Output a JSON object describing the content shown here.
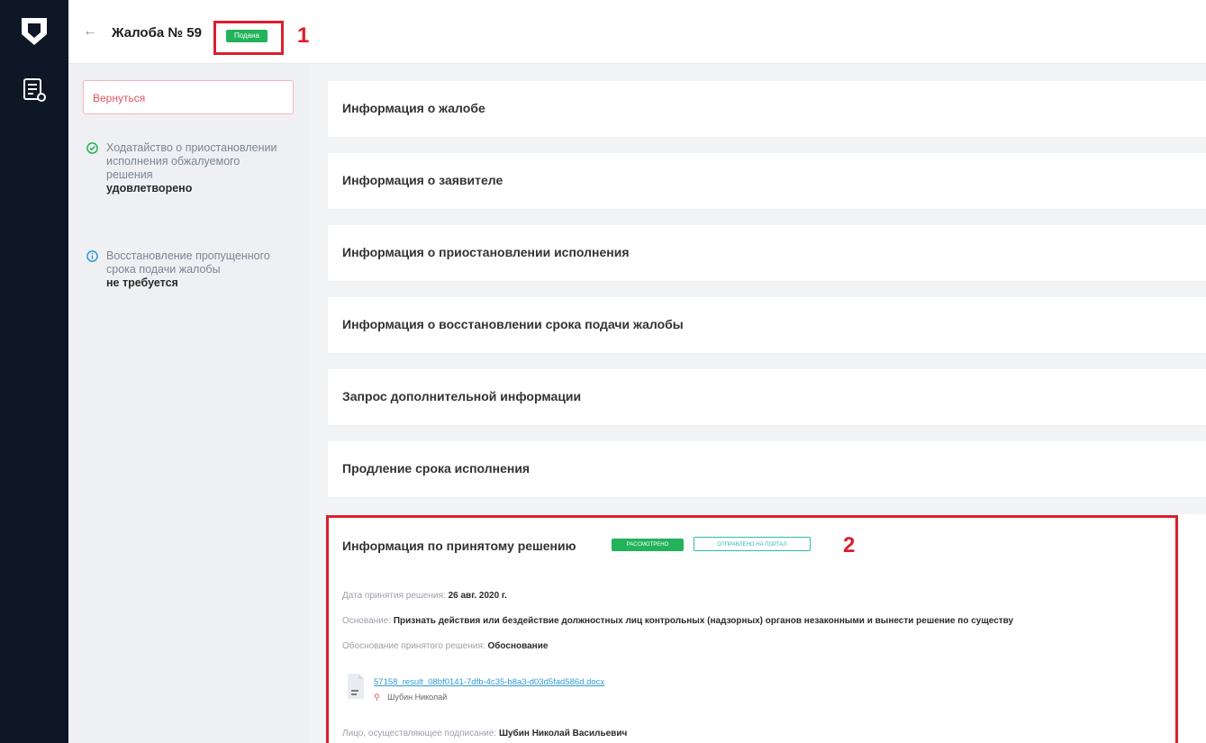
{
  "header": {
    "title": "Жалоба № 59",
    "status_badge": "Подана"
  },
  "annotations": {
    "n1": "1",
    "n2": "2"
  },
  "sidebar": {
    "return_label": "Вернуться",
    "items": [
      {
        "icon": "check-circle-icon",
        "text": "Ходатайство о приостановлении исполнения обжалуемого решения",
        "value": "удовлетворено"
      },
      {
        "icon": "info-circle-icon",
        "text": "Восстановление пропущенного срока подачи жалобы",
        "value": "не требуется"
      }
    ]
  },
  "sections": [
    {
      "title": "Информация о жалобе"
    },
    {
      "title": "Информация о заявителе"
    },
    {
      "title": "Информация о приостановлении исполнения"
    },
    {
      "title": "Информация о восстановлении срока подачи жалобы"
    },
    {
      "title": "Запрос дополнительной информации"
    },
    {
      "title": "Продление срока исполнения"
    }
  ],
  "decision": {
    "title": "Информация по принятому решению",
    "badge_status": "РАССМОТРЕНО",
    "badge_portal": "ОТПРАВЛЕНО НА ПОРТАЛ",
    "date_label": "Дата принятия решения:",
    "date_value": "26 авг. 2020 г.",
    "basis_label": "Основание:",
    "basis_value": "Признать действия или бездействие должностных лиц контрольных (надзорных) органов незаконными и вынести решение по существу",
    "justification_label": "Обоснование принятого решения:",
    "justification_value": "Обоснование",
    "file_name": "57158_result_08bf0141-7dfb-4c35-b8a3-d03d5fad586d.docx",
    "file_signer": "Шубин Николай",
    "signer_label": "Лицо, осуществляющее подписание:",
    "signer_value": "Шубин Николай Васильевич"
  },
  "colors": {
    "rail": "#0e1726",
    "accent_red": "#d91f2e",
    "badge_green": "#23b35a",
    "badge_teal": "#2dbbb1",
    "link": "#2f9bd6"
  }
}
